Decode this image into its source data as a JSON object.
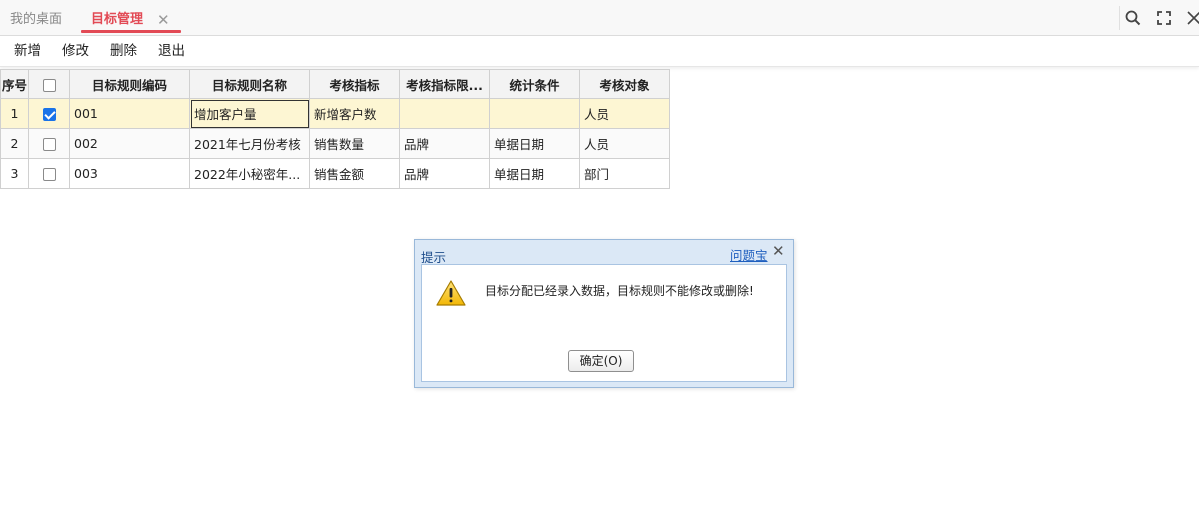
{
  "tabs": {
    "home_label": "我的桌面",
    "active_label": "目标管理",
    "close_glyph": "✕"
  },
  "window_icons": [
    "search-icon",
    "fullscreen-icon",
    "close-icon"
  ],
  "toolbar": {
    "add_label": "新增",
    "edit_label": "修改",
    "delete_label": "删除",
    "exit_label": "退出"
  },
  "table": {
    "headers": {
      "seq": "序号",
      "code": "目标规则编码",
      "name": "目标规则名称",
      "metric": "考核指标",
      "metric_limit": "考核指标限...",
      "condition": "统计条件",
      "target": "考核对象"
    },
    "rows": [
      {
        "seq": "1",
        "checked": true,
        "code": "001",
        "name": "增加客户量",
        "metric": "新增客户数",
        "metric_limit": "",
        "condition": "",
        "target": "人员"
      },
      {
        "seq": "2",
        "checked": false,
        "code": "002",
        "name": "2021年七月份考核",
        "metric": "销售数量",
        "metric_limit": "品牌",
        "condition": "单据日期",
        "target": "人员"
      },
      {
        "seq": "3",
        "checked": false,
        "code": "003",
        "name": "2022年小秘密年...",
        "metric": "销售金额",
        "metric_limit": "品牌",
        "condition": "单据日期",
        "target": "部门"
      }
    ]
  },
  "dialog": {
    "title": "提示",
    "help_link": "问题宝",
    "close_glyph": "✕",
    "message": "目标分配已经录入数据，目标规则不能修改或删除!",
    "ok_label": "确定(O)",
    "icon": "warning-icon"
  },
  "colors": {
    "active_tab": "#e24a55",
    "selected_row": "#fdf6d3",
    "dialog_frame": "#dbe8f6",
    "link": "#1f5fbf"
  }
}
